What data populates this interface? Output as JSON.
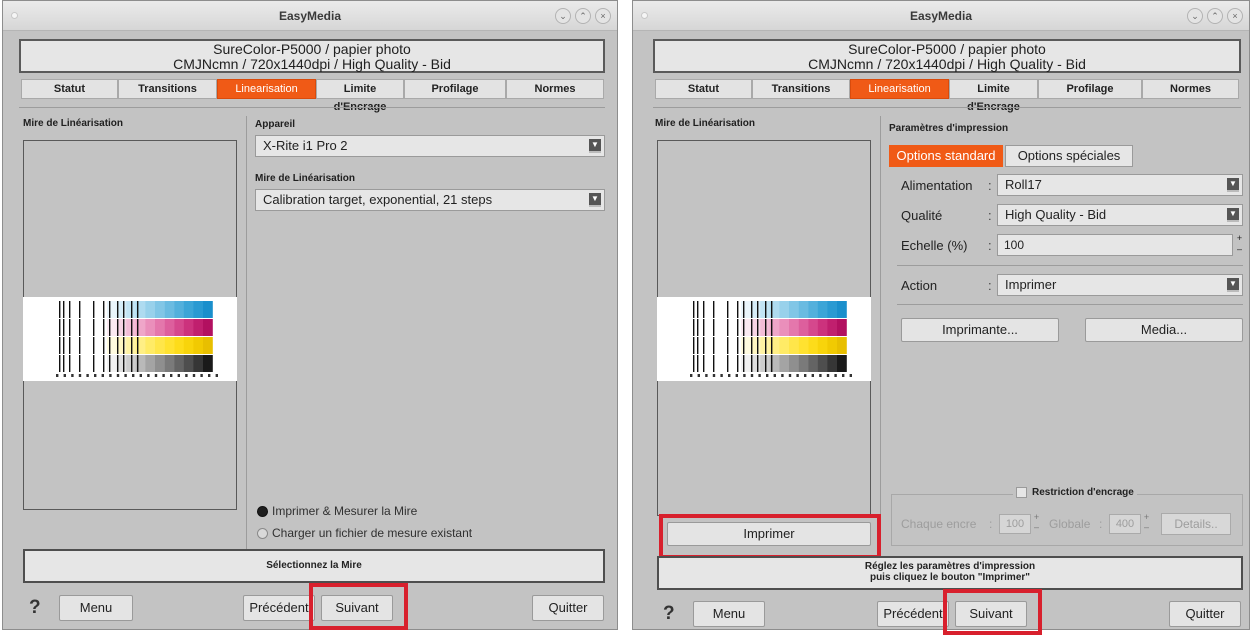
{
  "window": {
    "title": "EasyMedia",
    "printer_line1": "SureColor-P5000 / papier photo",
    "printer_line2": "CMJNcmn / 720x1440dpi / High Quality - Bid",
    "controls": [
      "⌄",
      "⌃",
      "×"
    ]
  },
  "tabs": [
    "Statut",
    "Transitions",
    "Linearisation",
    "Limite d'Encrage",
    "Profilage",
    "Normes"
  ],
  "active_tab": "Linearisation",
  "colors": {
    "accent": "#f05a16",
    "highlight": "#d8202d",
    "window_bg": "#c3c3c3"
  },
  "left": {
    "preview_label": "Mire de Linéarisation",
    "device_label": "Appareil",
    "device_value": "X-Rite i1 Pro 2",
    "target_label": "Mire de Linéarisation",
    "target_value": "Calibration target, exponential, 21 steps",
    "radio_print": "Imprimer & Mesurer la Mire",
    "radio_load": "Charger un fichier de mesure existant",
    "message": "Sélectionnez la Mire",
    "buttons": {
      "help": "?",
      "menu": "Menu",
      "previous": "Précédent",
      "next": "Suivant",
      "quit": "Quitter"
    }
  },
  "right": {
    "preview_label": "Mire de Linéarisation",
    "print_params_label": "Paramètres d'impression",
    "options_standard": "Options standard",
    "options_special": "Options spéciales",
    "rows": [
      {
        "label": "Alimentation",
        "value": "Roll17"
      },
      {
        "label": "Qualité",
        "value": "High Quality - Bid"
      },
      {
        "label": "Echelle (%)",
        "value": "100"
      },
      {
        "label": "Action",
        "value": "Imprimer"
      }
    ],
    "colon": ":",
    "printer_button": "Imprimante...",
    "media_button": "Media...",
    "restriction_label": "Restriction d'encrage",
    "each_ink_label": "Chaque encre",
    "each_ink_value": "100",
    "global_label": "Globale",
    "global_value": "400",
    "details_button": "Details..",
    "print_button": "Imprimer",
    "message_line1": "Réglez les paramètres d'impression",
    "message_line2": "puis cliquez le bouton \"Imprimer\"",
    "buttons": {
      "help": "?",
      "menu": "Menu",
      "previous": "Précédent",
      "next": "Suivant",
      "quit": "Quitter"
    }
  }
}
